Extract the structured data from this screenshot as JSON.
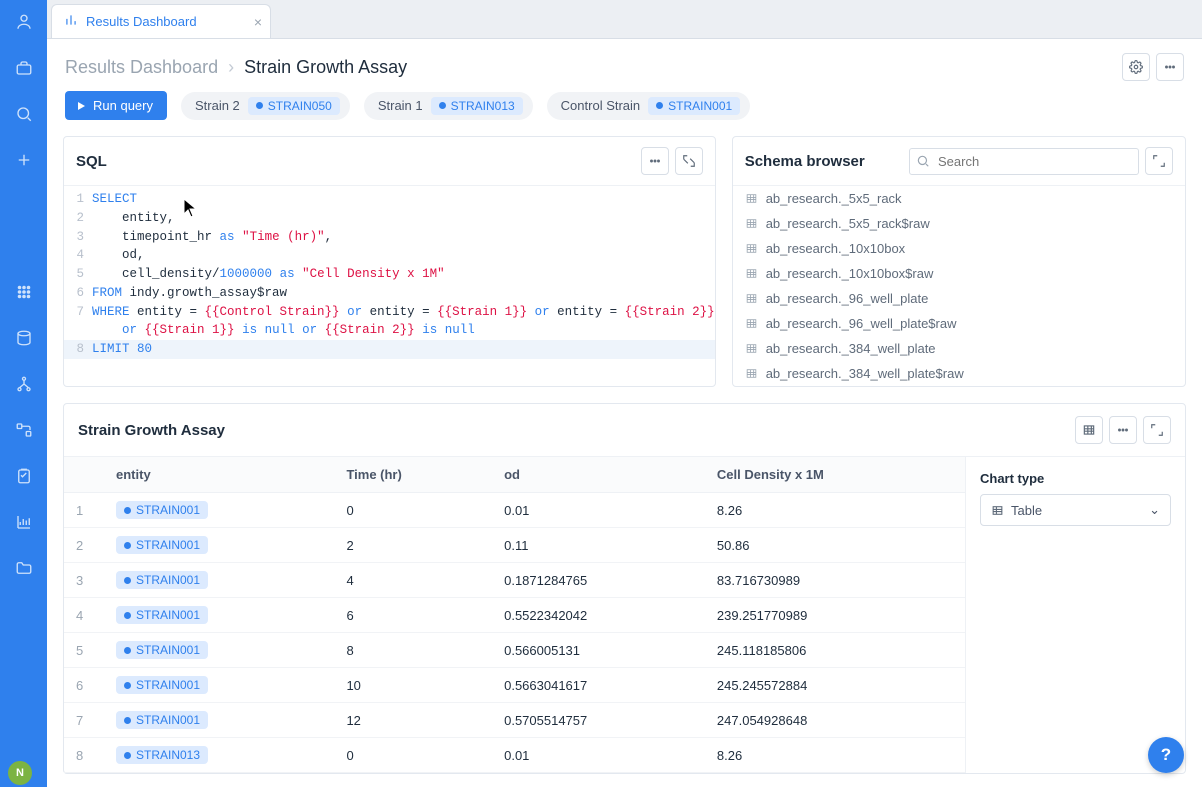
{
  "tab": {
    "label": "Results Dashboard"
  },
  "breadcrumb": {
    "root": "Results Dashboard",
    "current": "Strain Growth Assay"
  },
  "run_button": "Run query",
  "params": [
    {
      "label": "Control Strain",
      "value": "STRAIN001"
    },
    {
      "label": "Strain 1",
      "value": "STRAIN013"
    },
    {
      "label": "Strain 2",
      "value": "STRAIN050"
    }
  ],
  "sql_panel": {
    "title": "SQL"
  },
  "sql_lines": [
    {
      "n": 1,
      "html": "<span class='kw'>SELECT</span>"
    },
    {
      "n": 2,
      "html": "    entity,"
    },
    {
      "n": 3,
      "html": "    timepoint_hr <span class='kw'>as</span> <span class='str'>\"Time (hr)\"</span>,"
    },
    {
      "n": 4,
      "html": "    od,"
    },
    {
      "n": 5,
      "html": "    cell_density/<span class='num'>1000000</span> <span class='kw'>as</span> <span class='str'>\"Cell Density x 1M\"</span>"
    },
    {
      "n": 6,
      "html": "<span class='kw'>FROM</span> indy.growth_assay$raw"
    },
    {
      "n": 7,
      "html": "<span class='kw'>WHERE</span> entity = <span class='tmpl'>{{Control Strain}}</span> <span class='kw'>or</span> entity = <span class='tmpl'>{{Strain 1}}</span> <span class='kw'>or</span> entity = <span class='tmpl'>{{Strain 2}}</span>\n    <span class='kw'>or</span> <span class='tmpl'>{{Strain 1}}</span> <span class='kw'>is</span> <span class='kw'>null</span> <span class='kw'>or</span> <span class='tmpl'>{{Strain 2}}</span> <span class='kw'>is</span> <span class='kw'>null</span>"
    },
    {
      "n": 8,
      "html": "<span class='kw'>LIMIT</span> <span class='num'>80</span>",
      "hl": true
    }
  ],
  "schema": {
    "title": "Schema browser",
    "search_placeholder": "Search",
    "items": [
      "ab_research._5x5_rack",
      "ab_research._5x5_rack$raw",
      "ab_research._10x10box",
      "ab_research._10x10box$raw",
      "ab_research._96_well_plate",
      "ab_research._96_well_plate$raw",
      "ab_research._384_well_plate",
      "ab_research._384_well_plate$raw"
    ]
  },
  "results": {
    "title": "Strain Growth Assay",
    "columns": [
      "",
      "entity",
      "Time (hr)",
      "od",
      "Cell Density x 1M"
    ],
    "rows": [
      {
        "n": 1,
        "entity": "STRAIN001",
        "time": "0",
        "od": "0.01",
        "cd": "8.26"
      },
      {
        "n": 2,
        "entity": "STRAIN001",
        "time": "2",
        "od": "0.11",
        "cd": "50.86"
      },
      {
        "n": 3,
        "entity": "STRAIN001",
        "time": "4",
        "od": "0.1871284765",
        "cd": "83.716730989"
      },
      {
        "n": 4,
        "entity": "STRAIN001",
        "time": "6",
        "od": "0.5522342042",
        "cd": "239.251770989"
      },
      {
        "n": 5,
        "entity": "STRAIN001",
        "time": "8",
        "od": "0.566005131",
        "cd": "245.118185806"
      },
      {
        "n": 6,
        "entity": "STRAIN001",
        "time": "10",
        "od": "0.5663041617",
        "cd": "245.245572884"
      },
      {
        "n": 7,
        "entity": "STRAIN001",
        "time": "12",
        "od": "0.5705514757",
        "cd": "247.054928648"
      },
      {
        "n": 8,
        "entity": "STRAIN013",
        "time": "0",
        "od": "0.01",
        "cd": "8.26"
      }
    ],
    "chart_type_label": "Chart type",
    "chart_type_value": "Table"
  },
  "user_initial": "N"
}
